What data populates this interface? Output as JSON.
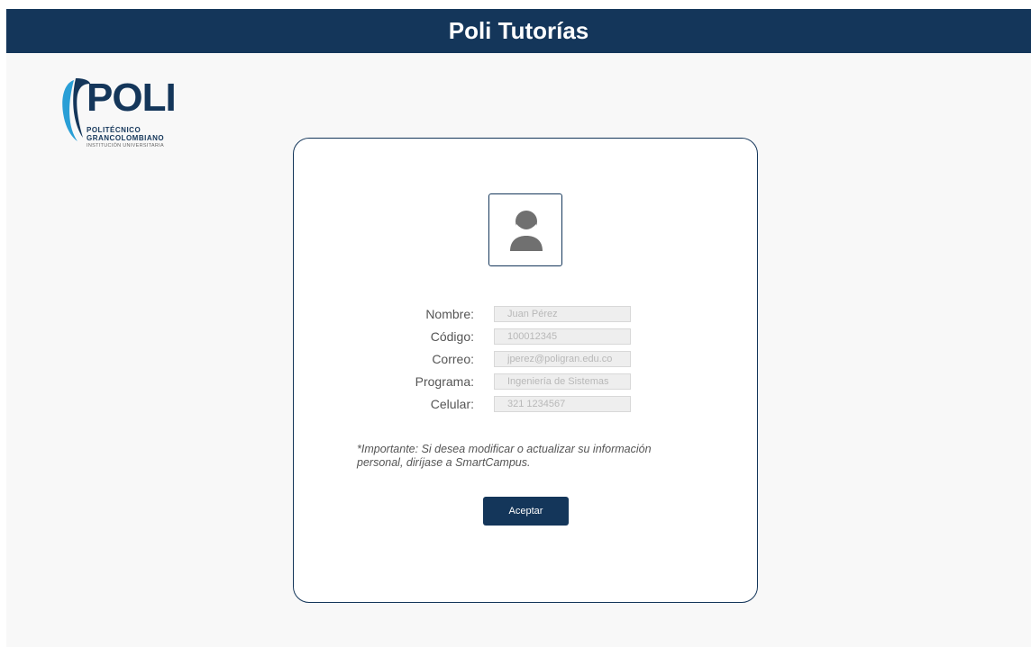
{
  "header": {
    "title": "Poli Tutorías"
  },
  "logo": {
    "wordmark": "POLI",
    "line1": "POLITÉCNICO",
    "line2": "GRANCOLOMBIANO",
    "line3": "INSTITUCIÓN UNIVERSITARIA"
  },
  "profile": {
    "avatar_icon": "user-icon",
    "fields": [
      {
        "label": "Nombre:",
        "value": "Juan Pérez"
      },
      {
        "label": "Código:",
        "value": "100012345"
      },
      {
        "label": "Correo:",
        "value": "jperez@poligran.edu.co"
      },
      {
        "label": "Programa:",
        "value": "Ingeniería de Sistemas"
      },
      {
        "label": "Celular:",
        "value": "321 1234567"
      }
    ],
    "note": "*Importante: Si desea modificar o actualizar su información personal, diríjase a SmartCampus.",
    "accept_label": "Aceptar"
  },
  "colors": {
    "primary": "#14365a",
    "background": "#f8f8f8",
    "logo_accent": "#2a9fd6"
  }
}
